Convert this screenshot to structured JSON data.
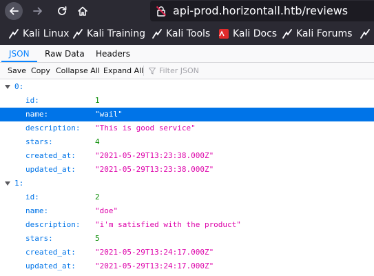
{
  "browser": {
    "url": "api-prod.horizontall.htb/reviews",
    "bookmarks": [
      {
        "label": "Kali Linux",
        "icon": "kali-dragon-icon"
      },
      {
        "label": "Kali Training",
        "icon": "kali-dragon-icon"
      },
      {
        "label": "Kali Tools",
        "icon": "kali-dragon-icon"
      },
      {
        "label": "Kali Docs",
        "icon": "kali-docs-icon"
      },
      {
        "label": "Kali Forums",
        "icon": "kali-dragon-icon"
      },
      {
        "label": "N",
        "icon": "kali-dragon-icon"
      }
    ]
  },
  "viewer": {
    "tabs": [
      {
        "label": "JSON",
        "active": true
      },
      {
        "label": "Raw Data",
        "active": false
      },
      {
        "label": "Headers",
        "active": false
      }
    ],
    "toolbar": {
      "save": "Save",
      "copy": "Copy",
      "collapse_all": "Collapse All",
      "expand_all": "Expand All",
      "filter_placeholder": "Filter JSON"
    }
  },
  "json": {
    "items": [
      {
        "key": "0:",
        "fields": [
          {
            "key": "id:",
            "value": "1",
            "type": "number"
          },
          {
            "key": "name:",
            "value": "\"wail\"",
            "type": "string",
            "selected": true
          },
          {
            "key": "description:",
            "value": "\"This is good service\"",
            "type": "string"
          },
          {
            "key": "stars:",
            "value": "4",
            "type": "number"
          },
          {
            "key": "created_at:",
            "value": "\"2021-05-29T13:23:38.000Z\"",
            "type": "string"
          },
          {
            "key": "updated_at:",
            "value": "\"2021-05-29T13:23:38.000Z\"",
            "type": "string"
          }
        ]
      },
      {
        "key": "1:",
        "fields": [
          {
            "key": "id:",
            "value": "2",
            "type": "number"
          },
          {
            "key": "name:",
            "value": "\"doe\"",
            "type": "string"
          },
          {
            "key": "description:",
            "value": "\"i'm satisfied with the product\"",
            "type": "string"
          },
          {
            "key": "stars:",
            "value": "5",
            "type": "number"
          },
          {
            "key": "created_at:",
            "value": "\"2021-05-29T13:24:17.000Z\"",
            "type": "string"
          },
          {
            "key": "updated_at:",
            "value": "\"2021-05-29T13:24:17.000Z\"",
            "type": "string"
          }
        ]
      }
    ]
  }
}
